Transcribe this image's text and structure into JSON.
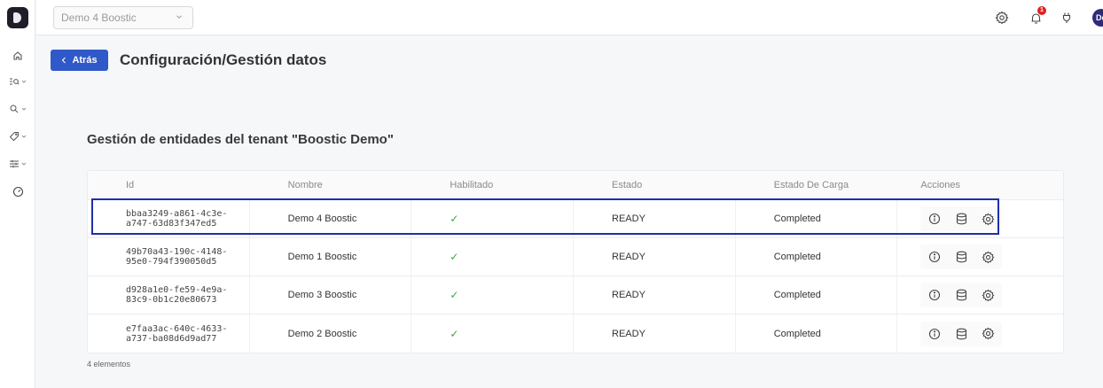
{
  "header": {
    "tenant_selected": "Demo 4 Boostic",
    "notification_count": "1",
    "avatar_initials": "De"
  },
  "sidebar": {
    "items": [
      {
        "icon": "home-icon"
      },
      {
        "icon": "list-search-icon"
      },
      {
        "icon": "search-icon"
      },
      {
        "icon": "tag-icon"
      },
      {
        "icon": "sliders-icon"
      },
      {
        "icon": "gauge-icon"
      }
    ]
  },
  "page": {
    "back_label": "Atrás",
    "title": "Configuración/Gestión datos",
    "section_title": "Gestión de entidades del tenant \"Boostic Demo\""
  },
  "table": {
    "columns": [
      "Id",
      "Nombre",
      "Habilitado",
      "Estado",
      "Estado De Carga",
      "Acciones"
    ],
    "rows": [
      {
        "id": "bbaa3249-a861-4c3e-a747-63d83f347ed5",
        "nombre": "Demo 4 Boostic",
        "habilitado": "✓",
        "estado": "READY",
        "carga": "Completed"
      },
      {
        "id": "49b70a43-190c-4148-95e0-794f390050d5",
        "nombre": "Demo 1 Boostic",
        "habilitado": "✓",
        "estado": "READY",
        "carga": "Completed"
      },
      {
        "id": "d928a1e0-fe59-4e9a-83c9-0b1c20e80673",
        "nombre": "Demo 3 Boostic",
        "habilitado": "✓",
        "estado": "READY",
        "carga": "Completed"
      },
      {
        "id": "e7faa3ac-640c-4633-a737-ba08d6d9ad77",
        "nombre": "Demo 2 Boostic",
        "habilitado": "✓",
        "estado": "READY",
        "carga": "Completed"
      }
    ],
    "action_icons": [
      "info-icon",
      "database-icon",
      "settings-icon"
    ]
  },
  "footer": {
    "count_label": "4 elementos"
  },
  "colors": {
    "primary": "#2f58c9",
    "highlight": "#1f2fa8",
    "check": "#3aa93a",
    "badge": "#e02020"
  }
}
